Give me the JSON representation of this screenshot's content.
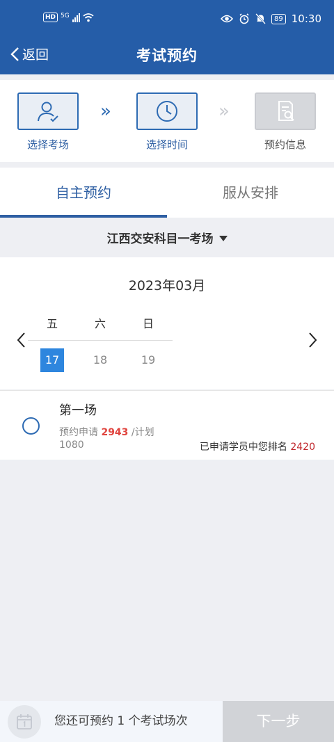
{
  "status_bar": {
    "hd": "HD",
    "network": "5G",
    "battery": "89",
    "time": "10:30"
  },
  "nav": {
    "back_label": "返回",
    "title": "考试预约"
  },
  "steps": [
    {
      "label": "选择考场",
      "icon": "user-check-icon",
      "state": "done"
    },
    {
      "label": "选择时间",
      "icon": "clock-icon",
      "state": "current"
    },
    {
      "label": "预约信息",
      "icon": "document-search-icon",
      "state": "pending"
    }
  ],
  "tabs": [
    {
      "label": "自主预约",
      "active": true
    },
    {
      "label": "服从安排",
      "active": false
    }
  ],
  "venue": {
    "name": "江西交安科目一考场"
  },
  "calendar": {
    "month": "2023年03月",
    "weekdays": [
      "五",
      "六",
      "日"
    ],
    "days": [
      {
        "label": "17",
        "selected": true
      },
      {
        "label": "18",
        "selected": false
      },
      {
        "label": "19",
        "selected": false
      }
    ]
  },
  "session": {
    "name": "第一场",
    "applied_label": "预约申请",
    "applied_count": "2943",
    "plan_label": "/计划",
    "plan_count": "1080",
    "rank_label": "已申请学员中您排名",
    "rank_value": "2420"
  },
  "bottom": {
    "remaining_text": "您还可预约 1 个考试场次",
    "next_label": "下一步"
  },
  "colors": {
    "primary": "#255da8",
    "accent_red": "#e0443e",
    "selected_day": "#2e86de"
  }
}
